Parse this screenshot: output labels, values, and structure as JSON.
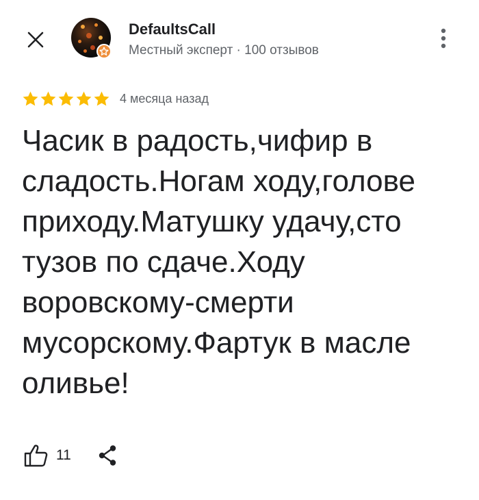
{
  "header": {
    "close_icon": "close-icon",
    "user": {
      "name": "DefaultsCall",
      "meta": "Местный эксперт · 100 отзывов",
      "badge_icon": "local-guide-star-icon",
      "badge_color": "#ee8f3c"
    },
    "more_icon": "more-vertical-icon"
  },
  "review": {
    "rating": 5,
    "rating_max": 5,
    "star_color": "#fbbc04",
    "date": "4 месяца назад",
    "text": "Часик в радость,чифир в сладость.Ногам ходу,голове приходу.Матушку удачу,сто тузов по сдаче.Ходу воровскому-смерти мусорскому.Фартук в масле оливье!"
  },
  "actions": {
    "like_icon": "thumbs-up-icon",
    "like_count": "11",
    "share_icon": "share-icon"
  }
}
